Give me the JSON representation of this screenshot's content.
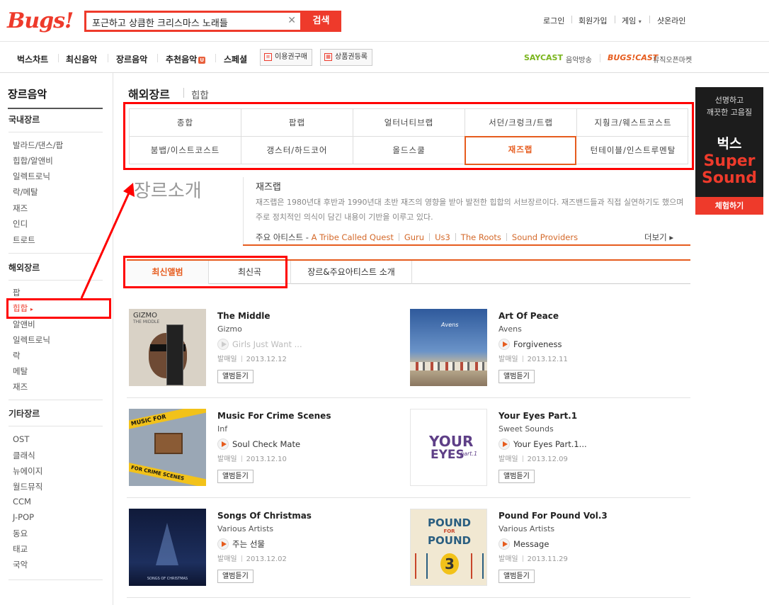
{
  "header": {
    "logo": "Bugs!",
    "search_value": "포근하고 상큼한 크리스마스 노래들",
    "search_button": "검색",
    "util_links": [
      "로그인",
      "회원가입",
      "게임",
      "샷온라인"
    ],
    "game_caret": "▾"
  },
  "gnb": {
    "items": [
      "벅스차트",
      "최신음악",
      "장르음악",
      "추천음악",
      "스페셜"
    ],
    "recommend_badge": "U",
    "buy_button": "이용권구매",
    "coupon_button": "상품권등록",
    "saycast_logo": "SAYCAST",
    "saycast_label": "음악방송",
    "bugscast_logo": "BUGS!CAST",
    "bugscast_label": "뮤직오픈마켓"
  },
  "lnb": {
    "title": "장르음악",
    "groups": [
      {
        "heading": "국내장르",
        "items": [
          "발라드/댄스/팝",
          "힙합/알앤비",
          "일렉트로닉",
          "락/메탈",
          "재즈",
          "인디",
          "트로트"
        ]
      },
      {
        "heading": "해외장르",
        "items": [
          "팝",
          "힙합",
          "알앤비",
          "일렉트로닉",
          "락",
          "메탈",
          "재즈"
        ]
      },
      {
        "heading": "기타장르",
        "items": [
          "OST",
          "클래식",
          "뉴에이지",
          "월드뮤직",
          "CCM",
          "J-POP",
          "동요",
          "태교",
          "국악"
        ]
      }
    ],
    "active_marker": "▸"
  },
  "page": {
    "title": "해외장르",
    "subtitle": "힙합"
  },
  "genre_tabs": [
    "종합",
    "팝랩",
    "얼터너티브랩",
    "서던/크렁크/트랩",
    "지훵크/웨스트코스트",
    "붐뱁/이스트코스트",
    "갱스터/하드코어",
    "올드스쿨",
    "재즈랩",
    "턴테이블/인스트루멘탈"
  ],
  "intro": {
    "heading": "장르소개",
    "title": "재즈랩",
    "description": "재즈랩은 1980년대 후반과 1990년대 초반 재즈의 영향을 받아 발전한 힙합의 서브장르이다. 재즈밴드들과 직접 실연하기도 했으며 주로 정치적인 의식이 담긴 내용이 기반을 이루고 있다.",
    "artists_label": "주요 아티스트 -",
    "artists": [
      "A Tribe Called Quest",
      "Guru",
      "Us3",
      "The Roots",
      "Sound Providers"
    ],
    "more": "더보기 ▸"
  },
  "content_tabs": [
    "최신앨범",
    "최신곡",
    "장르&주요아티스트 소개"
  ],
  "albums": [
    {
      "title": "The Middle",
      "artist": "Gizmo",
      "track": "Girls Just Want ...",
      "date_label": "발매일",
      "date": "2013.12.12",
      "button": "앨범듣기",
      "art_text": "GIZMO",
      "art_sub": "THE MIDDLE"
    },
    {
      "title": "Art Of Peace",
      "artist": "Avens",
      "track": "Forgiveness",
      "date_label": "발매일",
      "date": "2013.12.11",
      "button": "앨범듣기",
      "art_text": "Avens"
    },
    {
      "title": "Music For Crime Scenes",
      "artist": "Inf",
      "track": "Soul Check Mate",
      "date_label": "발매일",
      "date": "2013.12.10",
      "button": "앨범듣기",
      "art_text": "MUSIC FOR",
      "art_sub": "FOR CRIME SCENES"
    },
    {
      "title": "Your Eyes Part.1",
      "artist": "Sweet Sounds",
      "track": "Your Eyes Part.1...",
      "date_label": "발매일",
      "date": "2013.12.09",
      "button": "앨범듣기",
      "art_text": "YOUR",
      "art_sub": "EYES",
      "art_tag": "part.1"
    },
    {
      "title": "Songs Of Christmas",
      "artist": "Various Artists",
      "track": "주는 선물",
      "date_label": "발매일",
      "date": "2013.12.02",
      "button": "앨범듣기",
      "art_text": "SONGS OF CHRISTMAS"
    },
    {
      "title": "Pound For Pound Vol.3",
      "artist": "Various Artists",
      "track": "Message",
      "date_label": "발매일",
      "date": "2013.11.29",
      "button": "앨범듣기",
      "art_text": "POUND",
      "art_mid": "FOR",
      "art_sub": "POUND",
      "art_num": "3"
    }
  ],
  "ad": {
    "line1": "선명하고",
    "line2": "깨끗한 고음질",
    "brand": "벅스",
    "line3": "Super",
    "line4": "Sound",
    "button": "체험하기"
  }
}
